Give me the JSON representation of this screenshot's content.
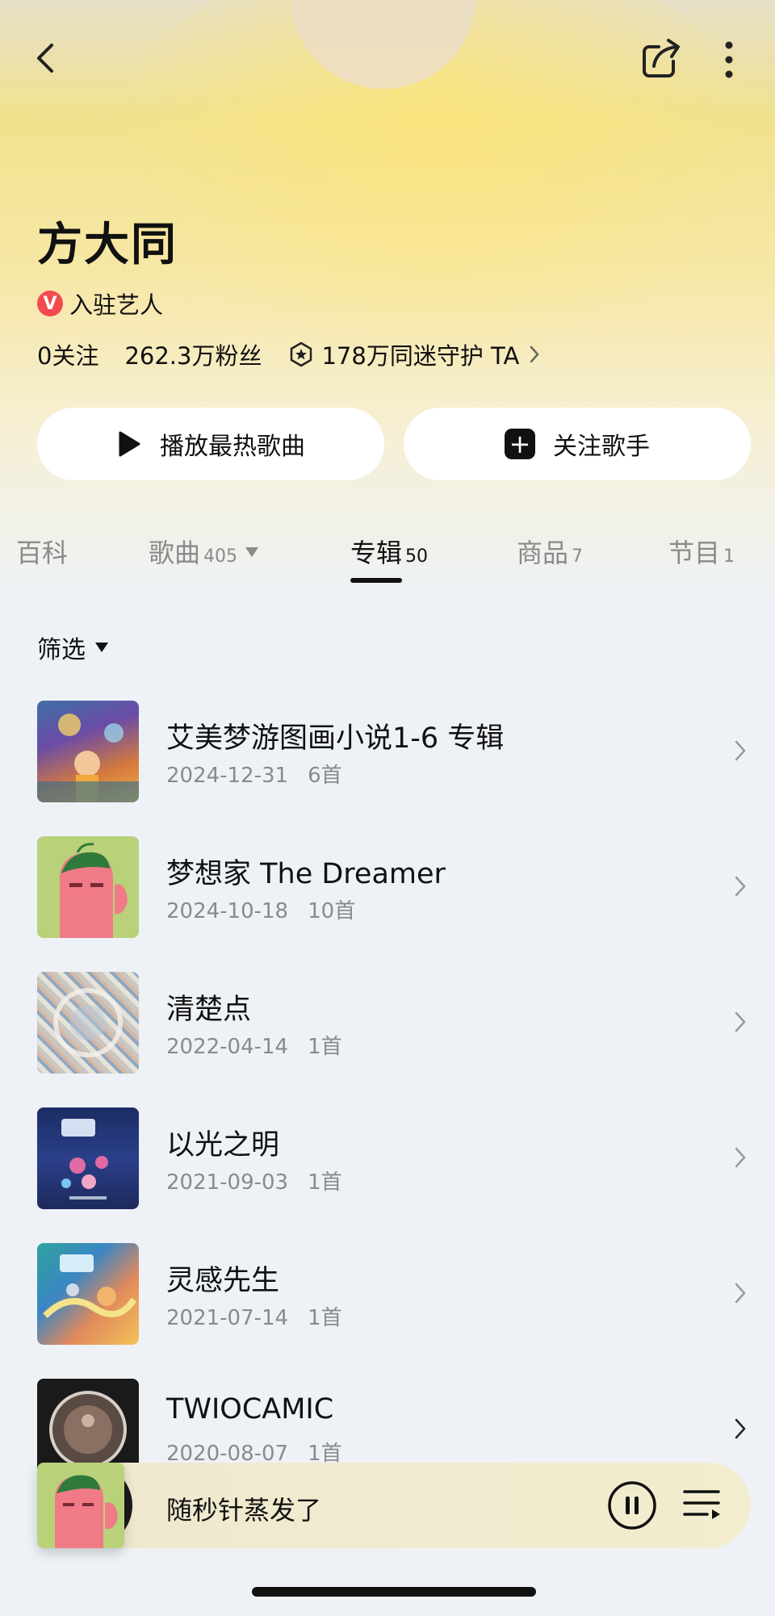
{
  "artist": {
    "name": "方大同",
    "verified_badge": "V",
    "verified_label": "入驻艺人",
    "following": "0关注",
    "fans": "262.3万粉丝",
    "guardians": "178万同迷守护 TA"
  },
  "actions": {
    "play_hot": "播放最热歌曲",
    "follow": "关注歌手"
  },
  "tabs": [
    {
      "label": "百科",
      "count": ""
    },
    {
      "label": "歌曲",
      "count": "405"
    },
    {
      "label": "专辑",
      "count": "50"
    },
    {
      "label": "商品",
      "count": "7"
    },
    {
      "label": "节目",
      "count": "1"
    }
  ],
  "active_tab": "专辑",
  "filter_label": "筛选",
  "albums": [
    {
      "title": "艾美梦游图画小说1-6 专辑",
      "date": "2024-12-31",
      "tracks": "6首"
    },
    {
      "title": "梦想家 The Dreamer",
      "date": "2024-10-18",
      "tracks": "10首"
    },
    {
      "title": "清楚点",
      "date": "2022-04-14",
      "tracks": "1首"
    },
    {
      "title": "以光之明",
      "date": "2021-09-03",
      "tracks": "1首"
    },
    {
      "title": "灵感先生",
      "date": "2021-07-14",
      "tracks": "1首"
    },
    {
      "title": "TWIOCAMIC",
      "date": "2020-08-07",
      "tracks": "1首"
    }
  ],
  "player": {
    "now_playing": "随秒针蒸发了"
  },
  "icons": {
    "back": "chevron-left-icon",
    "share": "share-icon",
    "more": "more-vertical-icon",
    "play": "play-icon",
    "add": "plus-icon",
    "pause": "pause-icon",
    "playlist": "playlist-icon"
  },
  "colors": {
    "verified_red": "#f24a4f",
    "hero_yellow": "#f3e39a",
    "background": "#eef2f6"
  }
}
